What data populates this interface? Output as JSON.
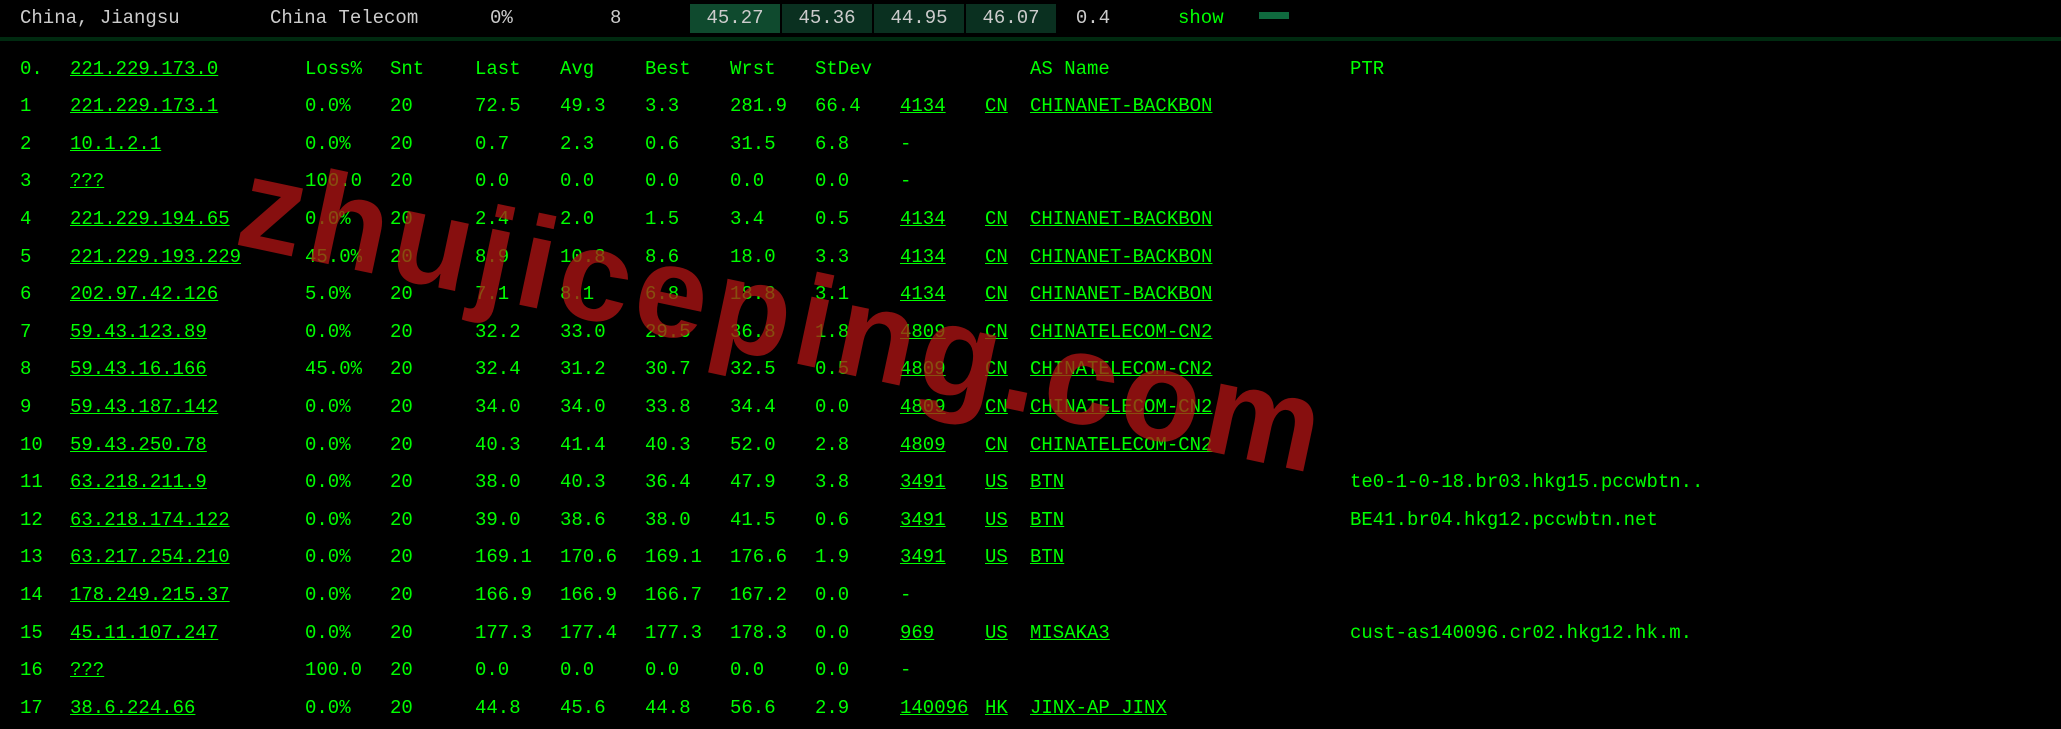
{
  "header": {
    "location": "China, Jiangsu",
    "isp": "China Telecom",
    "pct": "0%",
    "count": "8",
    "stat1": "45.27",
    "stat2": "45.36",
    "stat3": "44.95",
    "stat4": "46.07",
    "z": "0.4",
    "showlabel": "show"
  },
  "columns": {
    "hop": "0.",
    "host": "221.229.173.0",
    "loss": "Loss%",
    "snt": "Snt",
    "last": "Last",
    "avg": "Avg",
    "best": "Best",
    "wrst": "Wrst",
    "stdev": "StDev",
    "asname": "AS Name",
    "ptr": "PTR"
  },
  "hops": [
    {
      "n": "1",
      "host": "221.229.173.1",
      "loss": "0.0%",
      "snt": "20",
      "last": "72.5",
      "avg": "49.3",
      "best": "3.3",
      "wrst": "281.9",
      "stdev": "66.4",
      "as": "4134",
      "cc": "CN",
      "asname": "CHINANET-BACKBON",
      "ptr": ""
    },
    {
      "n": "2",
      "host": "10.1.2.1",
      "loss": "0.0%",
      "snt": "20",
      "last": "0.7",
      "avg": "2.3",
      "best": "0.6",
      "wrst": "31.5",
      "stdev": "6.8",
      "as": "-",
      "cc": "",
      "asname": "",
      "ptr": ""
    },
    {
      "n": "3",
      "host": "???",
      "loss": "100.0",
      "snt": "20",
      "last": "0.0",
      "avg": "0.0",
      "best": "0.0",
      "wrst": "0.0",
      "stdev": "0.0",
      "as": "-",
      "cc": "",
      "asname": "",
      "ptr": ""
    },
    {
      "n": "4",
      "host": "221.229.194.65",
      "loss": "0.0%",
      "snt": "20",
      "last": "2.4",
      "avg": "2.0",
      "best": "1.5",
      "wrst": "3.4",
      "stdev": "0.5",
      "as": "4134",
      "cc": "CN",
      "asname": "CHINANET-BACKBON",
      "ptr": ""
    },
    {
      "n": "5",
      "host": "221.229.193.229",
      "loss": "45.0%",
      "snt": "20",
      "last": "8.9",
      "avg": "10.8",
      "best": "8.6",
      "wrst": "18.0",
      "stdev": "3.3",
      "as": "4134",
      "cc": "CN",
      "asname": "CHINANET-BACKBON",
      "ptr": ""
    },
    {
      "n": "6",
      "host": "202.97.42.126",
      "loss": "5.0%",
      "snt": "20",
      "last": "7.1",
      "avg": "8.1",
      "best": "6.8",
      "wrst": "18.8",
      "stdev": "3.1",
      "as": "4134",
      "cc": "CN",
      "asname": "CHINANET-BACKBON",
      "ptr": ""
    },
    {
      "n": "7",
      "host": "59.43.123.89",
      "loss": "0.0%",
      "snt": "20",
      "last": "32.2",
      "avg": "33.0",
      "best": "29.5",
      "wrst": "36.8",
      "stdev": "1.8",
      "as": "4809",
      "cc": "CN",
      "asname": "CHINATELECOM-CN2",
      "ptr": ""
    },
    {
      "n": "8",
      "host": "59.43.16.166",
      "loss": "45.0%",
      "snt": "20",
      "last": "32.4",
      "avg": "31.2",
      "best": "30.7",
      "wrst": "32.5",
      "stdev": "0.5",
      "as": "4809",
      "cc": "CN",
      "asname": "CHINATELECOM-CN2",
      "ptr": ""
    },
    {
      "n": "9",
      "host": "59.43.187.142",
      "loss": "0.0%",
      "snt": "20",
      "last": "34.0",
      "avg": "34.0",
      "best": "33.8",
      "wrst": "34.4",
      "stdev": "0.0",
      "as": "4809",
      "cc": "CN",
      "asname": "CHINATELECOM-CN2",
      "ptr": ""
    },
    {
      "n": "10",
      "host": "59.43.250.78",
      "loss": "0.0%",
      "snt": "20",
      "last": "40.3",
      "avg": "41.4",
      "best": "40.3",
      "wrst": "52.0",
      "stdev": "2.8",
      "as": "4809",
      "cc": "CN",
      "asname": "CHINATELECOM-CN2",
      "ptr": ""
    },
    {
      "n": "11",
      "host": "63.218.211.9",
      "loss": "0.0%",
      "snt": "20",
      "last": "38.0",
      "avg": "40.3",
      "best": "36.4",
      "wrst": "47.9",
      "stdev": "3.8",
      "as": "3491",
      "cc": "US",
      "asname": "BTN",
      "ptr": "te0-1-0-18.br03.hkg15.pccwbtn.."
    },
    {
      "n": "12",
      "host": "63.218.174.122",
      "loss": "0.0%",
      "snt": "20",
      "last": "39.0",
      "avg": "38.6",
      "best": "38.0",
      "wrst": "41.5",
      "stdev": "0.6",
      "as": "3491",
      "cc": "US",
      "asname": "BTN",
      "ptr": "BE41.br04.hkg12.pccwbtn.net"
    },
    {
      "n": "13",
      "host": "63.217.254.210",
      "loss": "0.0%",
      "snt": "20",
      "last": "169.1",
      "avg": "170.6",
      "best": "169.1",
      "wrst": "176.6",
      "stdev": "1.9",
      "as": "3491",
      "cc": "US",
      "asname": "BTN",
      "ptr": ""
    },
    {
      "n": "14",
      "host": "178.249.215.37",
      "loss": "0.0%",
      "snt": "20",
      "last": "166.9",
      "avg": "166.9",
      "best": "166.7",
      "wrst": "167.2",
      "stdev": "0.0",
      "as": "-",
      "cc": "",
      "asname": "",
      "ptr": ""
    },
    {
      "n": "15",
      "host": "45.11.107.247",
      "loss": "0.0%",
      "snt": "20",
      "last": "177.3",
      "avg": "177.4",
      "best": "177.3",
      "wrst": "178.3",
      "stdev": "0.0",
      "as": "969",
      "cc": "US",
      "asname": "MISAKA3",
      "ptr": "cust-as140096.cr02.hkg12.hk.m."
    },
    {
      "n": "16",
      "host": "???",
      "loss": "100.0",
      "snt": "20",
      "last": "0.0",
      "avg": "0.0",
      "best": "0.0",
      "wrst": "0.0",
      "stdev": "0.0",
      "as": "-",
      "cc": "",
      "asname": "",
      "ptr": ""
    },
    {
      "n": "17",
      "host": "38.6.224.66",
      "loss": "0.0%",
      "snt": "20",
      "last": "44.8",
      "avg": "45.6",
      "best": "44.8",
      "wrst": "56.6",
      "stdev": "2.9",
      "as": "140096",
      "cc": "HK",
      "asname": "JINX-AP JINX",
      "ptr": ""
    }
  ],
  "watermark": "zhujiceping.com"
}
